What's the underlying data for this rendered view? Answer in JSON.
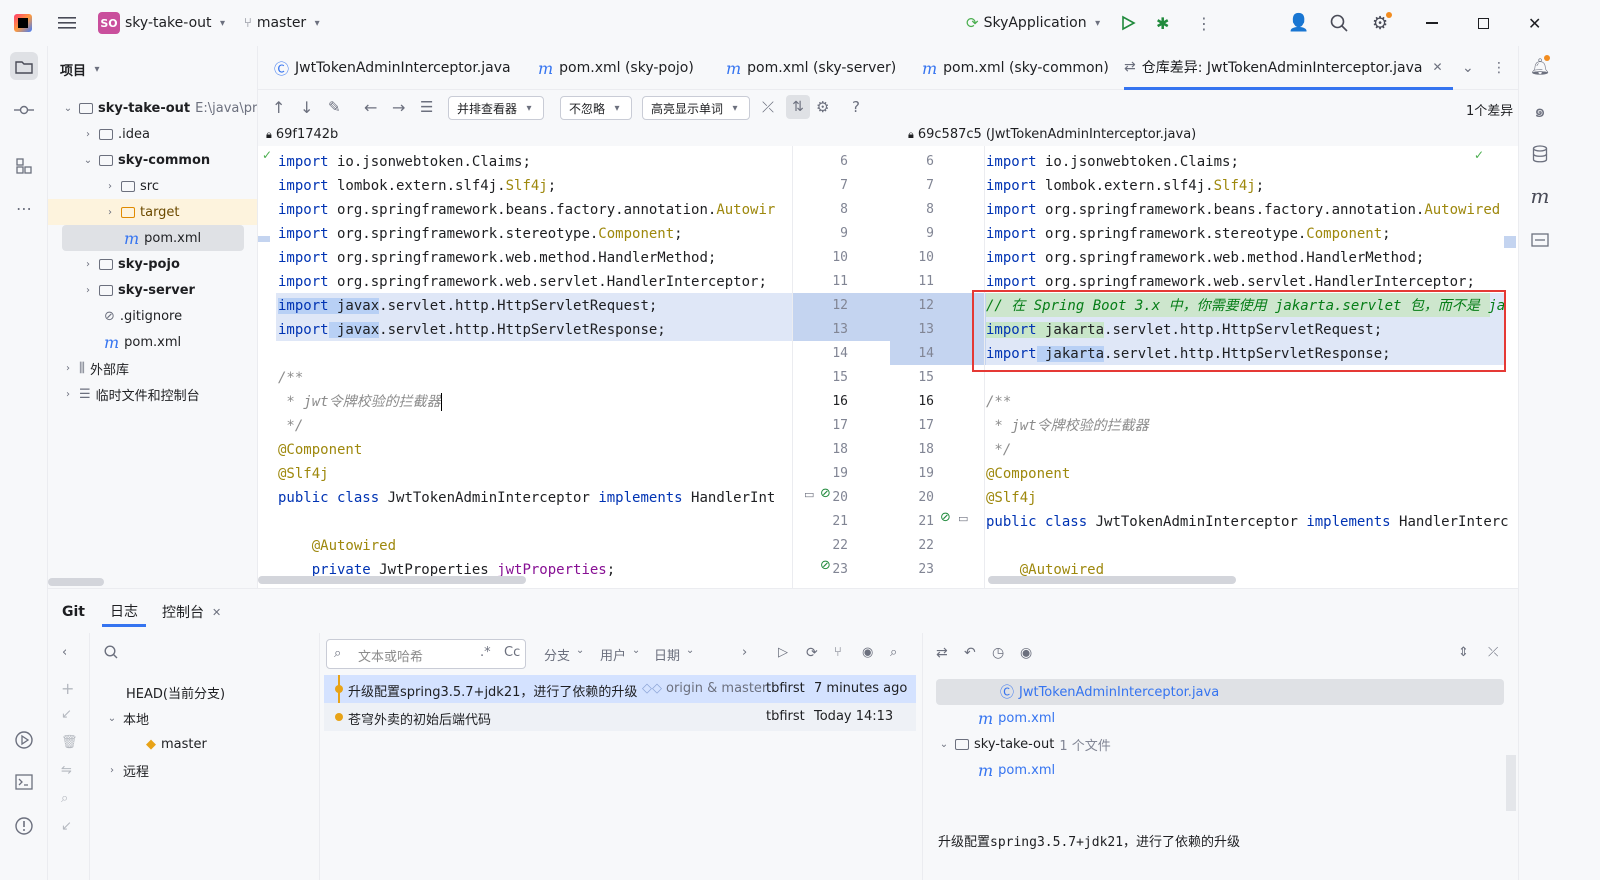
{
  "titlebar": {
    "project_badge": "SO",
    "project_name": "sky-take-out",
    "branch": "master",
    "run_config": "SkyApplication"
  },
  "project_panel": {
    "title": "项目",
    "root_name": "sky-take-out",
    "root_path": "E:\\java\\pro",
    "items": [
      {
        "label": ".idea"
      },
      {
        "label": "sky-common"
      },
      {
        "label": "src"
      },
      {
        "label": "target"
      },
      {
        "label": "pom.xml"
      },
      {
        "label": "sky-pojo"
      },
      {
        "label": "sky-server"
      },
      {
        "label": ".gitignore"
      },
      {
        "label": "pom.xml"
      },
      {
        "label": "外部库"
      },
      {
        "label": "临时文件和控制台"
      }
    ]
  },
  "tabs": [
    {
      "label": "JwtTokenAdminInterceptor.java"
    },
    {
      "label": "pom.xml (sky-pojo)"
    },
    {
      "label": "pom.xml (sky-server)"
    },
    {
      "label": "pom.xml (sky-common)"
    },
    {
      "label": "仓库差异: JwtTokenAdminInterceptor.java"
    }
  ],
  "diff_toolbar": {
    "viewer": "并排查看器",
    "ignore": "不忽略",
    "highlight": "高亮显示单词",
    "diff_count": "1个差异"
  },
  "diff": {
    "left_rev": "69f1742b",
    "right_rev": "69c587c5 (JwtTokenAdminInterceptor.java)",
    "left_numbers": [
      "6",
      "7",
      "8",
      "9",
      "10",
      "11",
      "12",
      "13",
      "14",
      "15",
      "16",
      "17",
      "18",
      "19",
      "20",
      "21",
      "22",
      "23"
    ],
    "right_numbers": [
      "6",
      "7",
      "8",
      "9",
      "10",
      "11",
      "12",
      "13",
      "14",
      "15",
      "16",
      "17",
      "18",
      "19",
      "20",
      "21",
      "22",
      "23"
    ],
    "left_lines": {
      "l1_kw": "import",
      "l1": " io.jsonwebtoken.Claims;",
      "l2_kw": "import",
      "l2a": " lombok.extern.slf4j.",
      "l2b": "Slf4j",
      "l2c": ";",
      "l3_kw": "import",
      "l3a": " org.springframework.beans.factory.annotation.",
      "l3b": "Autowir",
      "l4_kw": "import",
      "l4a": " org.springframework.stereotype.",
      "l4b": "Component",
      "l4c": ";",
      "l5_kw": "import",
      "l5": " org.springframework.web.method.HandlerMethod;",
      "l6_kw": "import",
      "l6": " org.springframework.web.servlet.HandlerInterceptor;",
      "l7_kw": "import",
      "l7a": " javax",
      "l7b": ".servlet.http.HttpServletRequest;",
      "l8_kw": "import",
      "l8a": " javax",
      "l8b": ".servlet.http.HttpServletResponse;",
      "l10": "/**",
      "l11": " * jwt令牌校验的拦截器",
      "l12": " */",
      "l13": "@Component",
      "l14": "@Slf4j",
      "l15_kw": "public class",
      "l15a": " JwtTokenAdminInterceptor ",
      "l15_kw2": "implements",
      "l15b": " HandlerInt",
      "l17": "    @Autowired",
      "l18_kw": "    private",
      "l18a": " JwtProperties ",
      "l18b": "jwtProperties",
      "l18c": ";"
    },
    "right_lines": {
      "l1_kw": "import",
      "l1": " io.jsonwebtoken.Claims;",
      "l2_kw": "import",
      "l2a": " lombok.extern.slf4j.",
      "l2b": "Slf4j",
      "l2c": ";",
      "l3_kw": "import",
      "l3a": " org.springframework.beans.factory.annotation.",
      "l3b": "Autowired",
      "l4_kw": "import",
      "l4a": " org.springframework.stereotype.",
      "l4b": "Component",
      "l4c": ";",
      "l5_kw": "import",
      "l5": " org.springframework.web.method.HandlerMethod;",
      "l6_kw": "import",
      "l6": " org.springframework.web.servlet.HandlerInterceptor;",
      "l7": "// 在 Spring Boot 3.x 中，你需要使用 jakarta.servlet 包，而不是 ja",
      "l8_kw": "import",
      "l8a": " jakarta",
      "l8b": ".servlet.http.HttpServletRequest;",
      "l9_kw": "import",
      "l9a": " jakarta",
      "l9b": ".servlet.http.HttpServletResponse;",
      "l11": "/**",
      "l12": " * jwt令牌校验的拦截器",
      "l13": " */",
      "l14": "@Component",
      "l15": "@Slf4j",
      "l16_kw": "public class",
      "l16a": " JwtTokenAdminInterceptor ",
      "l16_kw2": "implements",
      "l16b": " HandlerInterc",
      "l18": "    @Autowired"
    }
  },
  "bottom": {
    "tabs": [
      "Git",
      "日志",
      "控制台"
    ],
    "branches": {
      "head": "HEAD(当前分支)",
      "local": "本地",
      "master": "master",
      "remote": "远程"
    },
    "search_placeholder": "文本或哈希",
    "regex": ".*",
    "case": "Cc",
    "filters": [
      "分支",
      "用户",
      "日期"
    ],
    "commits": [
      {
        "message": "升级配置spring3.5.7+jdk21，进行了依赖的升级",
        "refs": "origin & master",
        "author": "tbfirst",
        "date": "7 minutes ago"
      },
      {
        "message": "苍穹外卖的初始后端代码",
        "refs": "",
        "author": "tbfirst",
        "date": "Today 14:13"
      }
    ],
    "changes": {
      "file1": "JwtTokenAdminInterceptor.java",
      "file2": "pom.xml",
      "module": "sky-take-out",
      "module_count": "1 个文件",
      "file3": "pom.xml"
    },
    "commit_message": "升级配置spring3.5.7+jdk21，进行了依赖的升级"
  },
  "colors": {
    "changed_bg": "#dfe7f7",
    "changed_gutter": "#c4d4f0",
    "word_highlight": "#b8d0f5",
    "inserted_word": "#c8e6c9",
    "annotation_box": "#e53935",
    "accent": "#3574f0"
  }
}
